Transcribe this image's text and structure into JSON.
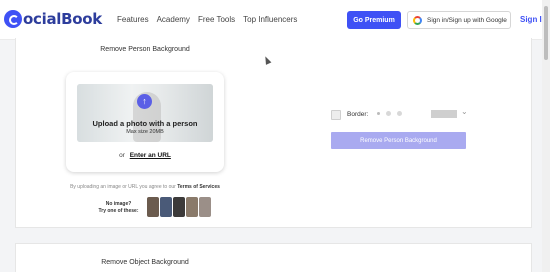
{
  "header": {
    "logo_text": "ocialBook",
    "nav": [
      "Features",
      "Academy",
      "Free Tools",
      "Top Influencers"
    ],
    "premium_label": "Go Premium",
    "google_label": "Sign in/Sign up with Google",
    "signin_label": "Sign In"
  },
  "main": {
    "title": "Remove Person Background",
    "upload_text": "Upload a photo with a person",
    "upload_sub": "Max size 20MB",
    "or_text": "or",
    "url_link": "Enter an URL",
    "disclaimer_text": "By uploading an image or URL you agree to our",
    "terms_link": "Terms of Services",
    "samples_label_1": "No image?",
    "samples_label_2": "Try one of these:",
    "sample_colors": [
      "#6b5b4e",
      "#4a5a78",
      "#3c3a3a",
      "#8a7a6a",
      "#9b8f88"
    ],
    "border_label": "Border:",
    "action_label": "Remove Person Background",
    "accent": "#3f51f5"
  },
  "second": {
    "title": "Remove Object Background"
  }
}
